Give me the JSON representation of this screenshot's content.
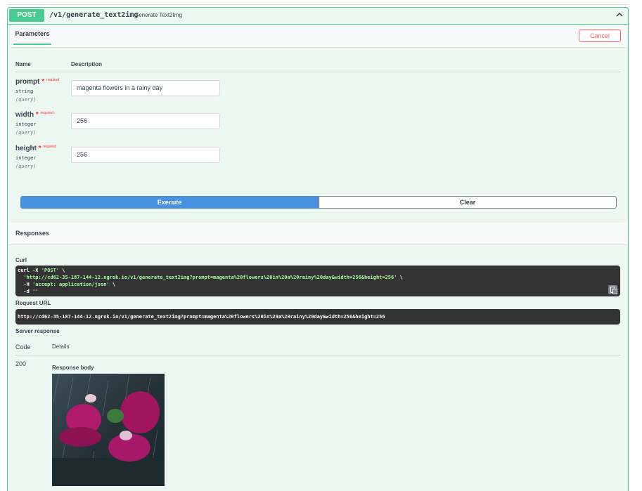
{
  "operation": {
    "method": "POST",
    "path": "/v1/generate_text2img",
    "summary": "Generate Text2Img"
  },
  "tabs": {
    "parameters": "Parameters"
  },
  "buttons": {
    "cancel": "Cancel",
    "execute": "Execute",
    "clear": "Clear"
  },
  "table_headers": {
    "name": "Name",
    "description": "Description"
  },
  "parameters": [
    {
      "name": "prompt",
      "required_mark": "*",
      "required_text": "required",
      "type": "string",
      "in": "(query)",
      "value": "magenta flowers in a rainy day"
    },
    {
      "name": "width",
      "required_mark": "*",
      "required_text": "required",
      "type": "integer",
      "in": "(query)",
      "value": "256"
    },
    {
      "name": "height",
      "required_mark": "*",
      "required_text": "required",
      "type": "integer",
      "in": "(query)",
      "value": "256"
    }
  ],
  "responses": {
    "title": "Responses",
    "curl_label": "Curl",
    "curl_lines": [
      {
        "plain": "curl -X ",
        "str": "'POST'",
        "tail": " \\"
      },
      {
        "plain": "  ",
        "str": "'http://cd62-35-187-144-12.ngrok.io/v1/generate_text2img?prompt=magenta%20flowers%20in%20a%20rainy%20day&width=256&height=256'",
        "tail": " \\"
      },
      {
        "plain": "  -H ",
        "str": "'accept: application/json'",
        "tail": " \\"
      },
      {
        "plain": "  -d ",
        "str": "''",
        "tail": ""
      }
    ],
    "request_url_label": "Request URL",
    "request_url": "http://cd62-35-187-144-12.ngrok.io/v1/generate_text2img?prompt=magenta%20flowers%20in%20a%20rainy%20day&width=256&height=256",
    "server_response_label": "Server response",
    "code_header": "Code",
    "details_header": "Details",
    "code": "200",
    "body_label": "Response body"
  },
  "icons": {
    "collapse": "chevron-up-icon",
    "copy": "copy-icon"
  },
  "colors": {
    "post": "#49cc90",
    "execute": "#4990e2",
    "cancel": "#ff6060",
    "required": "#ff2a2a",
    "code_bg": "#333333"
  }
}
